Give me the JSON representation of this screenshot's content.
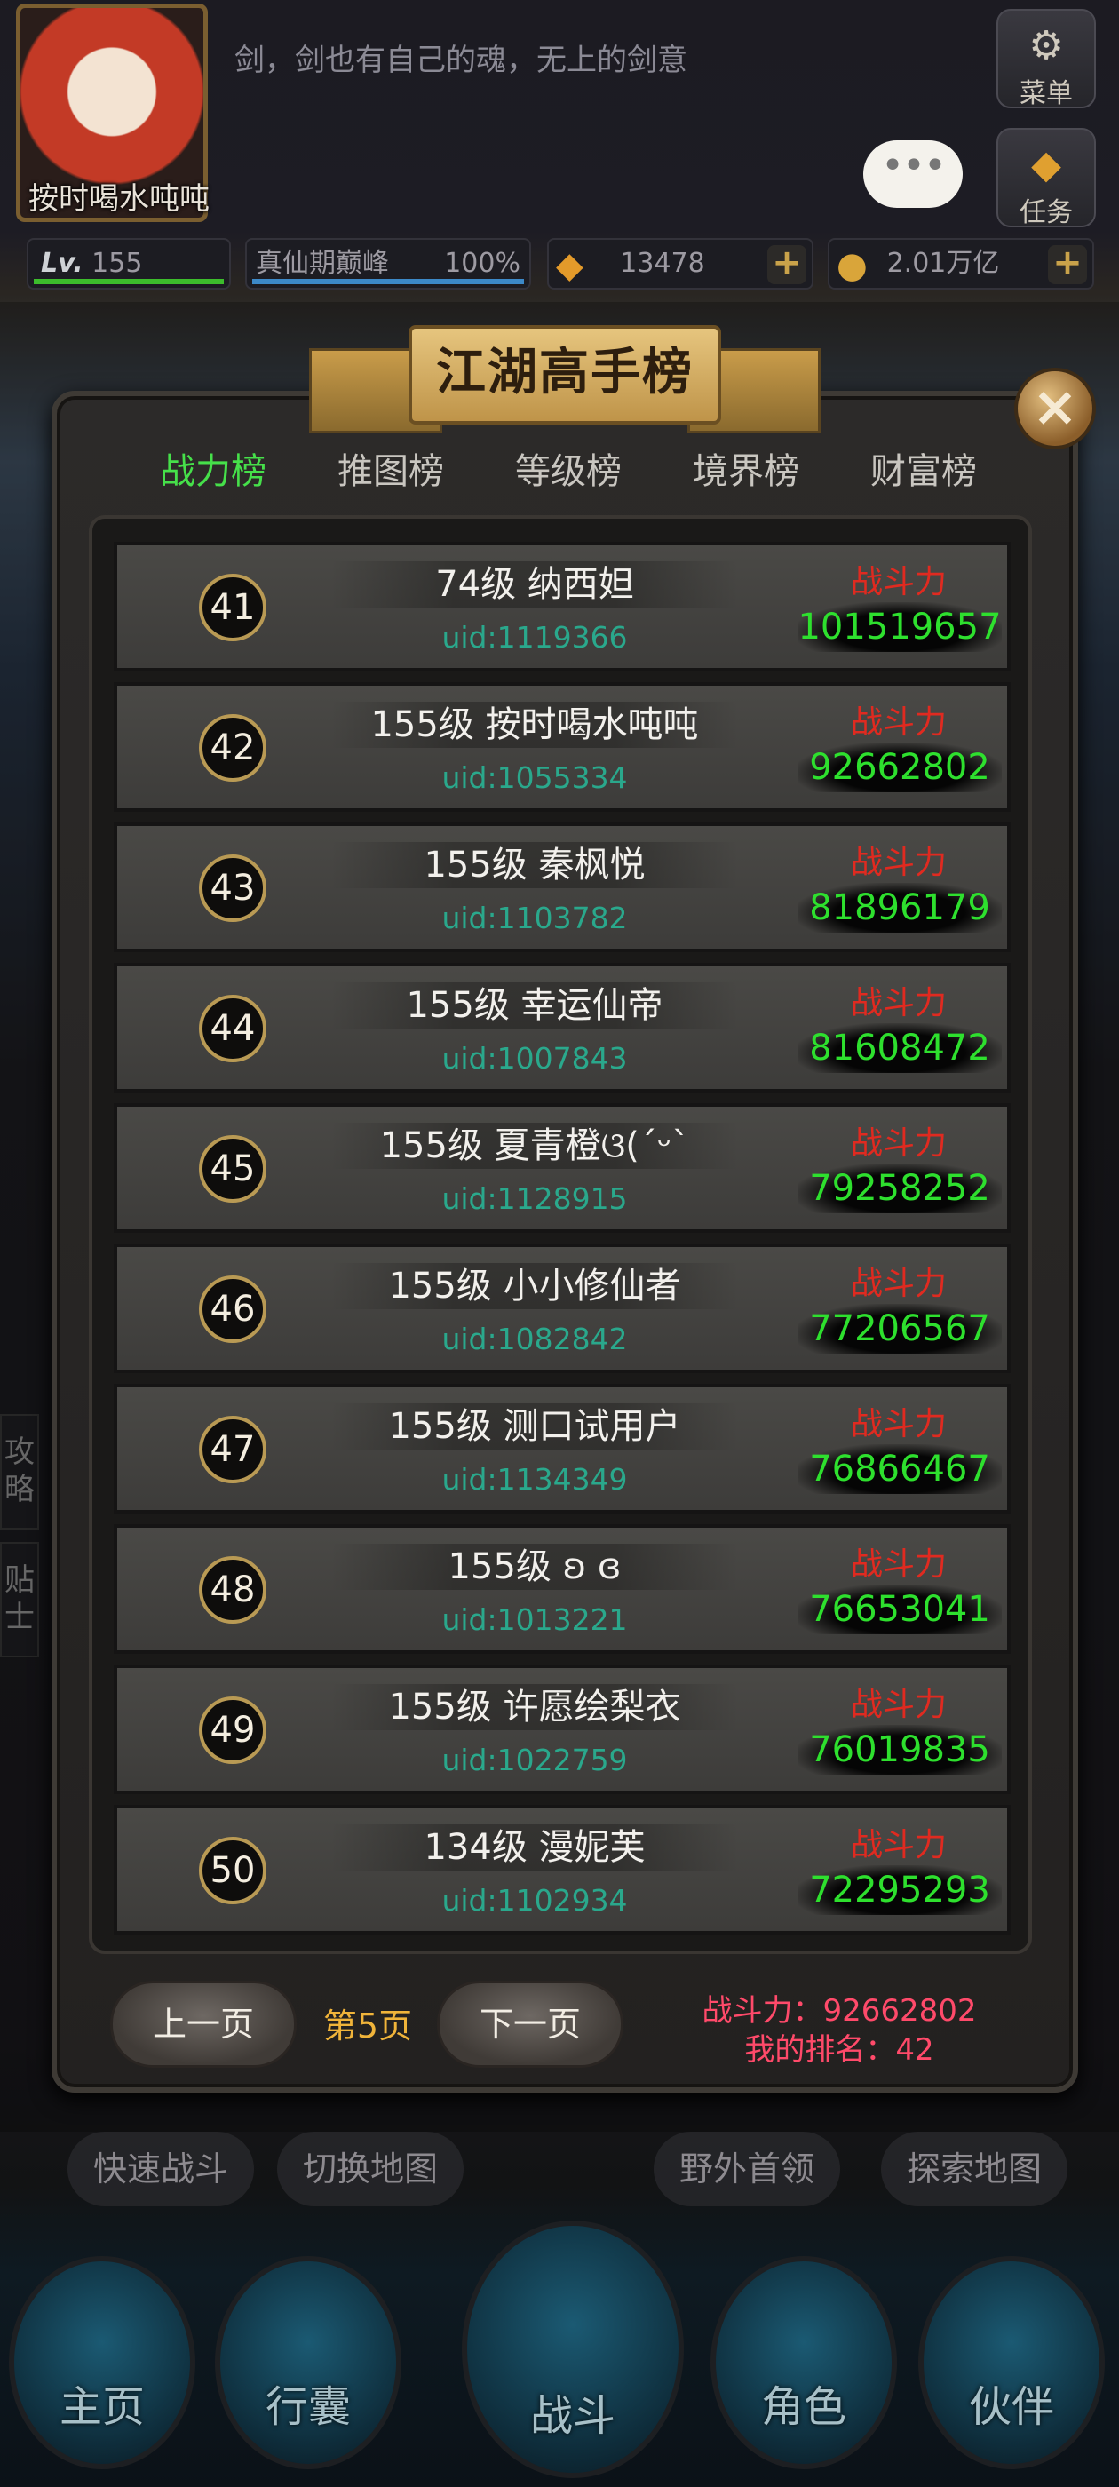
{
  "hud": {
    "player_name": "按时喝水吨吨",
    "motto": "剑，剑也有自己的魂，无上的剑意",
    "menu_label": "菜单",
    "task_label": "任务",
    "chat_dots": "•••",
    "level": "155",
    "level_prefix": "Lv.",
    "level_progress": 1.0,
    "realm": "真仙期巅峰",
    "realm_percent": "100%",
    "realm_progress": 1.0,
    "gems": "13478",
    "gold": "2.01万亿"
  },
  "modal": {
    "title": "江湖高手榜",
    "tabs": [
      "战力榜",
      "推图榜",
      "等级榜",
      "境界榜",
      "财富榜"
    ],
    "active_tab": 0,
    "power_label": "战斗力",
    "rows": [
      {
        "rank": "41",
        "name": "74级 纳西妲",
        "uid": "uid:1119366",
        "power": "101519657"
      },
      {
        "rank": "42",
        "name": "155级 按时喝水吨吨",
        "uid": "uid:1055334",
        "power": "92662802"
      },
      {
        "rank": "43",
        "name": "155级 秦枫悦",
        "uid": "uid:1103782",
        "power": "81896179"
      },
      {
        "rank": "44",
        "name": "155级 幸运仙帝",
        "uid": "uid:1007843",
        "power": "81608472"
      },
      {
        "rank": "45",
        "name": "155级 夏青橙ଓ(ˊᵕˋ",
        "uid": "uid:1128915",
        "power": "79258252"
      },
      {
        "rank": "46",
        "name": "155级 小小修仙者",
        "uid": "uid:1082842",
        "power": "77206567"
      },
      {
        "rank": "47",
        "name": "155级 测口试用户",
        "uid": "uid:1134349",
        "power": "76866467"
      },
      {
        "rank": "48",
        "name": "155级 ʚ ɞ",
        "uid": "uid:1013221",
        "power": "76653041"
      },
      {
        "rank": "49",
        "name": "155级 许愿绘梨衣",
        "uid": "uid:1022759",
        "power": "76019835"
      },
      {
        "rank": "50",
        "name": "134级 漫妮芙",
        "uid": "uid:1102934",
        "power": "72295293"
      }
    ],
    "prev_label": "上一页",
    "next_label": "下一页",
    "page_label": "第5页",
    "my_power": "战斗力：92662802",
    "my_rank": "我的排名：42"
  },
  "background": {
    "quick_buttons": [
      "快速战斗",
      "切换地图",
      "野外首领",
      "探索地图"
    ],
    "side_tabs": [
      "攻略",
      "贴士"
    ],
    "nav": [
      "主页",
      "行囊",
      "战斗",
      "角色",
      "伙伴"
    ]
  }
}
